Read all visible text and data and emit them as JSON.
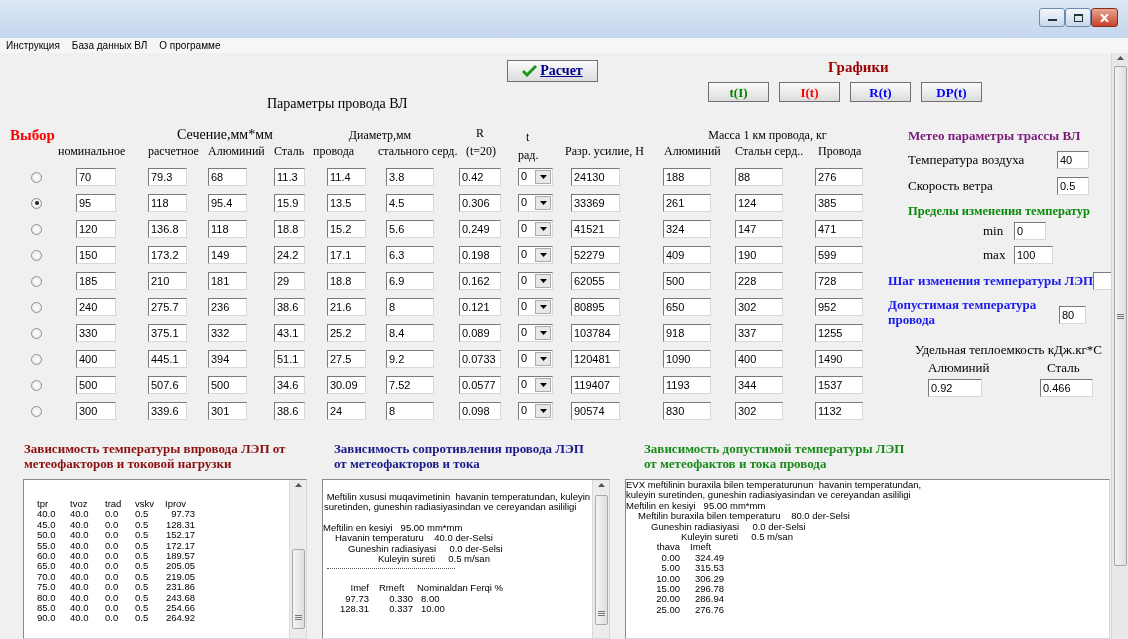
{
  "menu": [
    {
      "label": "Инструкция"
    },
    {
      "label": "База данных ВЛ"
    },
    {
      "label": "О программе"
    }
  ],
  "calc_button": {
    "label": "Расчет"
  },
  "charts": {
    "title": "Графики",
    "buttons": [
      {
        "label": "t(I)",
        "color": "#008000"
      },
      {
        "label": "I(t)",
        "color": "#ff0000"
      },
      {
        "label": "R(t)",
        "color": "#0000ff"
      },
      {
        "label": "DP(t)",
        "color": "#0000ff"
      }
    ]
  },
  "table": {
    "title": "Параметры провода ВЛ",
    "select_label": "Выбор",
    "groups": [
      {
        "label": "Сечение,мм*мм"
      },
      {
        "label": "Диаметр,мм"
      },
      {
        "label": "Масса 1 км провода, кг"
      }
    ],
    "columns": [
      {
        "label": "номинальное",
        "kind": "field"
      },
      {
        "label": "расчетное",
        "kind": "field"
      },
      {
        "label": "Алюминий",
        "kind": "field"
      },
      {
        "label": "Сталь",
        "kind": "field"
      },
      {
        "label": "провода",
        "kind": "field"
      },
      {
        "label": "стального серд.",
        "kind": "field"
      },
      {
        "top": "R",
        "label": "(t=20)",
        "kind": "field"
      },
      {
        "top": "t",
        "label": "рад.",
        "kind": "dropdown"
      },
      {
        "label": "Разр. усилие, Н",
        "kind": "field"
      },
      {
        "label": "Алюминий",
        "kind": "field"
      },
      {
        "label": "Стальн серд..",
        "kind": "field"
      },
      {
        "label": "Провода",
        "kind": "field"
      }
    ],
    "rows": [
      {
        "selected": false,
        "values": [
          "70",
          "79.3",
          "68",
          "11.3",
          "11.4",
          "3.8",
          "0.42",
          "0",
          "24130",
          "188",
          "88",
          "276"
        ]
      },
      {
        "selected": true,
        "values": [
          "95",
          "118",
          "95.4",
          "15.9",
          "13.5",
          "4.5",
          "0.306",
          "0",
          "33369",
          "261",
          "124",
          "385"
        ]
      },
      {
        "selected": false,
        "values": [
          "120",
          "136.8",
          "118",
          "18.8",
          "15.2",
          "5.6",
          "0.249",
          "0",
          "41521",
          "324",
          "147",
          "471"
        ]
      },
      {
        "selected": false,
        "values": [
          "150",
          "173.2",
          "149",
          "24.2",
          "17.1",
          "6.3",
          "0.198",
          "0",
          "52279",
          "409",
          "190",
          "599"
        ]
      },
      {
        "selected": false,
        "values": [
          "185",
          "210",
          "181",
          "29",
          "18.8",
          "6.9",
          "0.162",
          "0",
          "62055",
          "500",
          "228",
          "728"
        ]
      },
      {
        "selected": false,
        "values": [
          "240",
          "275.7",
          "236",
          "38.6",
          "21.6",
          "8",
          "0.121",
          "0",
          "80895",
          "650",
          "302",
          "952"
        ]
      },
      {
        "selected": false,
        "values": [
          "330",
          "375.1",
          "332",
          "43.1",
          "25.2",
          "8.4",
          "0.089",
          "0",
          "103784",
          "918",
          "337",
          "1255"
        ]
      },
      {
        "selected": false,
        "values": [
          "400",
          "445.1",
          "394",
          "51.1",
          "27.5",
          "9.2",
          "0.0733",
          "0",
          "120481",
          "1090",
          "400",
          "1490"
        ]
      },
      {
        "selected": false,
        "values": [
          "500",
          "507.6",
          "500",
          "34.6",
          "30.09",
          "7.52",
          "0.0577",
          "0",
          "119407",
          "1193",
          "344",
          "1537"
        ]
      },
      {
        "selected": false,
        "values": [
          "300",
          "339.6",
          "301",
          "38.6",
          "24",
          "8",
          "0.098",
          "0",
          "90574",
          "830",
          "302",
          "1132"
        ]
      }
    ]
  },
  "weather": {
    "title": "Метео параметры трассы ВЛ",
    "fields": [
      {
        "label": "Температура воздуха",
        "value": "40"
      },
      {
        "label": "Скорость ветра",
        "value": "0.5"
      }
    ]
  },
  "temp_range": {
    "title": "Пределы изменения температур",
    "fields": [
      {
        "label": "min",
        "value": "0"
      },
      {
        "label": "max",
        "value": "100"
      }
    ]
  },
  "temp_step": {
    "label": "Шаг изменения температуры ЛЭП"
  },
  "allowed_temp": {
    "label": "Допустимая температура\nпровода",
    "value": "80"
  },
  "heat_capacity": {
    "title": "Удельная теплоемкость кДж.кг*С",
    "fields": [
      {
        "label": "Алюминий",
        "value": "0.92"
      },
      {
        "label": "Сталь",
        "value": "0.466"
      }
    ]
  },
  "outputs": [
    {
      "kind": "table",
      "title": "Зависимость температуры впровода ЛЭП от\nметеофакторов и токовой нагрузки",
      "color": "#8b1010",
      "scrollbar": true,
      "columns": [
        "tpr",
        "tvoz",
        "trad",
        "vskv",
        "Iprov"
      ],
      "rows": [
        [
          "40.0",
          "40.0",
          "0.0",
          "0.5",
          "97.73"
        ],
        [
          "45.0",
          "40.0",
          "0.0",
          "0.5",
          "128.31"
        ],
        [
          "50.0",
          "40.0",
          "0.0",
          "0.5",
          "152.17"
        ],
        [
          "55.0",
          "40.0",
          "0.0",
          "0.5",
          "172.17"
        ],
        [
          "60.0",
          "40.0",
          "0.0",
          "0.5",
          "189.57"
        ],
        [
          "65.0",
          "40.0",
          "0.0",
          "0.5",
          "205.05"
        ],
        [
          "70.0",
          "40.0",
          "0.0",
          "0.5",
          "219.05"
        ],
        [
          "75.0",
          "40.0",
          "0.0",
          "0.5",
          "231.86"
        ],
        [
          "80.0",
          "40.0",
          "0.0",
          "0.5",
          "243.68"
        ],
        [
          "85.0",
          "40.0",
          "0.0",
          "0.5",
          "254.66"
        ],
        [
          "90.0",
          "40.0",
          "0.0",
          "0.5",
          "264.92"
        ]
      ]
    },
    {
      "kind": "report",
      "title": "Зависимость сопротивления провода ЛЭП\nот метеофакторов и тока",
      "color": "#1a1a8c",
      "scrollbar": true,
      "separator": true,
      "intro": " Meftilin xususi muqavimetinin  havanin temperatundan, kuleyin\nsuretinden, guneshin radiasiyasindan ve cereyandan asililigi",
      "params": [
        "Meftilin en kesiyi   95.00 mm*mm",
        "Havanin temperaturu    40.0 der-Selsi",
        "Guneshin radiasiyasi     0.0 der-Selsi",
        "Kuleyin sureti     0.5 m/san"
      ],
      "columns": [
        "Imef",
        "Rmeft",
        "Nominaldan Ferqi %"
      ],
      "rows": [
        [
          "97.73",
          "0.330",
          "8.00"
        ],
        [
          "128.31",
          "0.337",
          "10.00"
        ]
      ]
    },
    {
      "kind": "report",
      "title": "Зависимость допустимой температуры ЛЭП\nот метеофактов и тока провода",
      "color": "#1a8a1a",
      "scrollbar": false,
      "separator": false,
      "intro": "EVX meftilinin buraxila bilen temperaturunun  havanin temperatundan,\nkuleyin suretinden, guneshin radiasiyasindan ve cereyandan asililigi",
      "params": [
        "Meftilin en kesiyi   95.00 mm*mm",
        "Meftilin buraxila bilen temperaturu    80.0 der-Selsi",
        "Guneshin radiasiyasi     0.0 der-Selsi",
        "Kuleyin sureti     0.5 m/san"
      ],
      "columns": [
        "thava",
        "Imeft"
      ],
      "rows": [
        [
          "0.00",
          "324.49"
        ],
        [
          "5.00",
          "315.53"
        ],
        [
          "10.00",
          "306.29"
        ],
        [
          "15.00",
          "296.78"
        ],
        [
          "20.00",
          "286.94"
        ],
        [
          "25.00",
          "276.76"
        ]
      ]
    }
  ]
}
